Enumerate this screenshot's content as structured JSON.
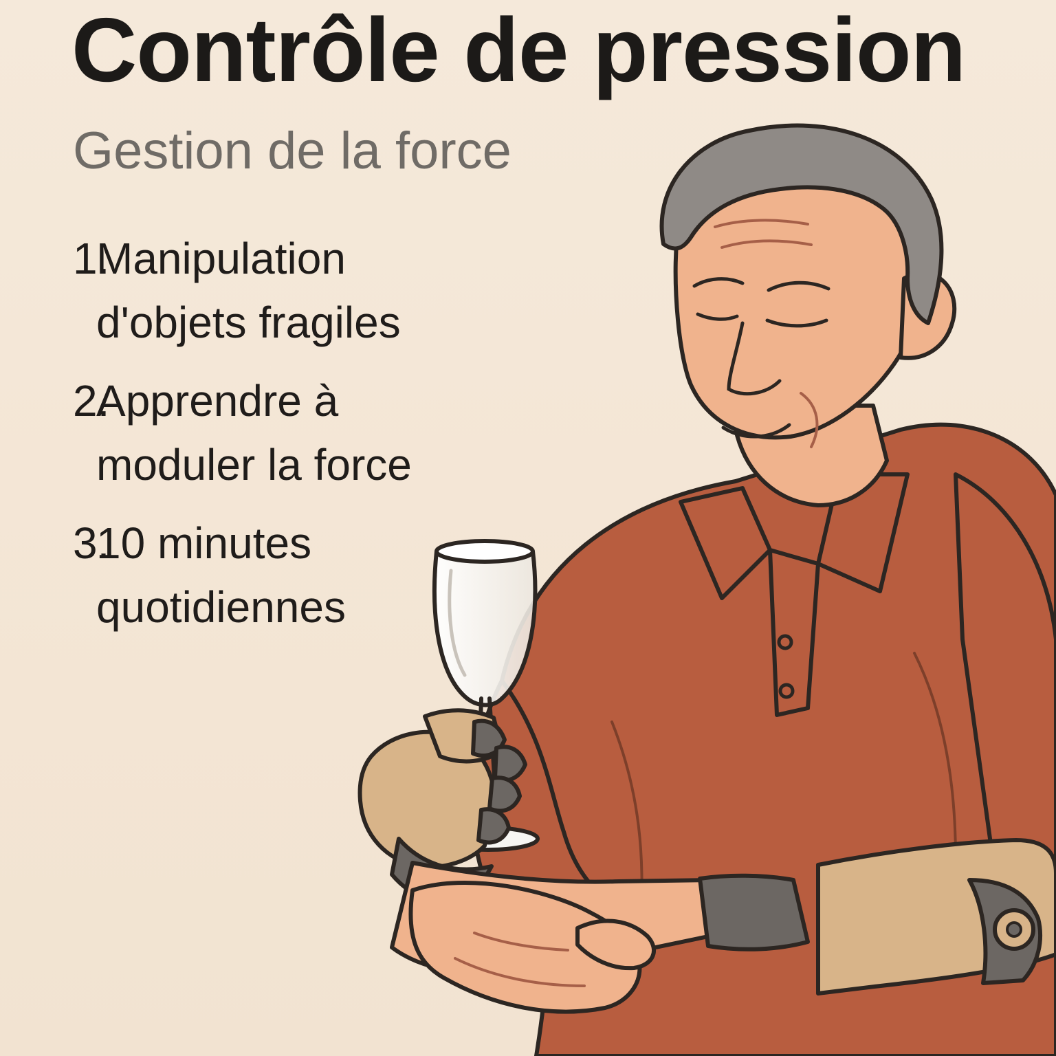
{
  "poster": {
    "title": "Contrôle de pression",
    "subtitle": "Gestion de la force",
    "steps": [
      {
        "number": "1.",
        "text": "Manipulation d'objets fragiles"
      },
      {
        "number": "2.",
        "text": "Apprendre à moduler la force"
      },
      {
        "number": "3.",
        "text": "10 minutes quotidiennes"
      }
    ]
  },
  "illustration": {
    "elements": [
      "older-man",
      "wine-glass",
      "prosthetic-hand",
      "prosthetic-arm"
    ]
  },
  "colors": {
    "background": "#f3e6d6",
    "title": "#1c1a18",
    "subtitle": "#6f6b66",
    "text": "#1f1c1a",
    "shirt": "#b85d3f",
    "skin": "#f0b38d",
    "hair": "#8f8a86",
    "prosthetic": "#d8b489",
    "prosthetic_dark": "#6c6763",
    "glass": "#f7f6f3",
    "outline": "#2c2622"
  }
}
